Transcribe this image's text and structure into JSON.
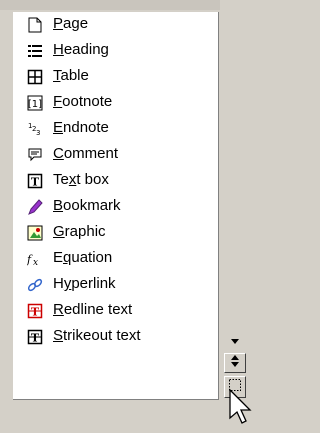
{
  "menu": {
    "items": [
      {
        "id": "page",
        "pre": "",
        "accel": "P",
        "post": "age",
        "icon": "page-icon"
      },
      {
        "id": "heading",
        "pre": "",
        "accel": "H",
        "post": "eading",
        "icon": "heading-icon"
      },
      {
        "id": "table",
        "pre": "",
        "accel": "T",
        "post": "able",
        "icon": "table-icon"
      },
      {
        "id": "footnote",
        "pre": "",
        "accel": "F",
        "post": "ootnote",
        "icon": "footnote-icon"
      },
      {
        "id": "endnote",
        "pre": "",
        "accel": "E",
        "post": "ndnote",
        "icon": "endnote-icon"
      },
      {
        "id": "comment",
        "pre": "",
        "accel": "C",
        "post": "omment",
        "icon": "comment-icon"
      },
      {
        "id": "text-box",
        "pre": "Te",
        "accel": "x",
        "post": "t box",
        "icon": "text-box-icon"
      },
      {
        "id": "bookmark",
        "pre": "",
        "accel": "B",
        "post": "ookmark",
        "icon": "bookmark-icon"
      },
      {
        "id": "graphic",
        "pre": "",
        "accel": "G",
        "post": "raphic",
        "icon": "graphic-icon"
      },
      {
        "id": "equation",
        "pre": "E",
        "accel": "q",
        "post": "uation",
        "icon": "equation-icon"
      },
      {
        "id": "hyperlink",
        "pre": "H",
        "accel": "y",
        "post": "perlink",
        "icon": "hyperlink-icon"
      },
      {
        "id": "redline-text",
        "pre": "",
        "accel": "R",
        "post": "edline text",
        "icon": "redline-text-icon"
      },
      {
        "id": "strikeout-text",
        "pre": "",
        "accel": "S",
        "post": "trikeout text",
        "icon": "strikeout-text-icon"
      }
    ]
  },
  "scroll": {
    "down_icon": "arrow-down-icon",
    "both_icon": "arrow-updown-icon",
    "select_icon": "dotted-select-icon"
  },
  "colors": {
    "panel": "#ffffff",
    "chrome": "#d4d0c8",
    "redline": "#cc0000"
  }
}
